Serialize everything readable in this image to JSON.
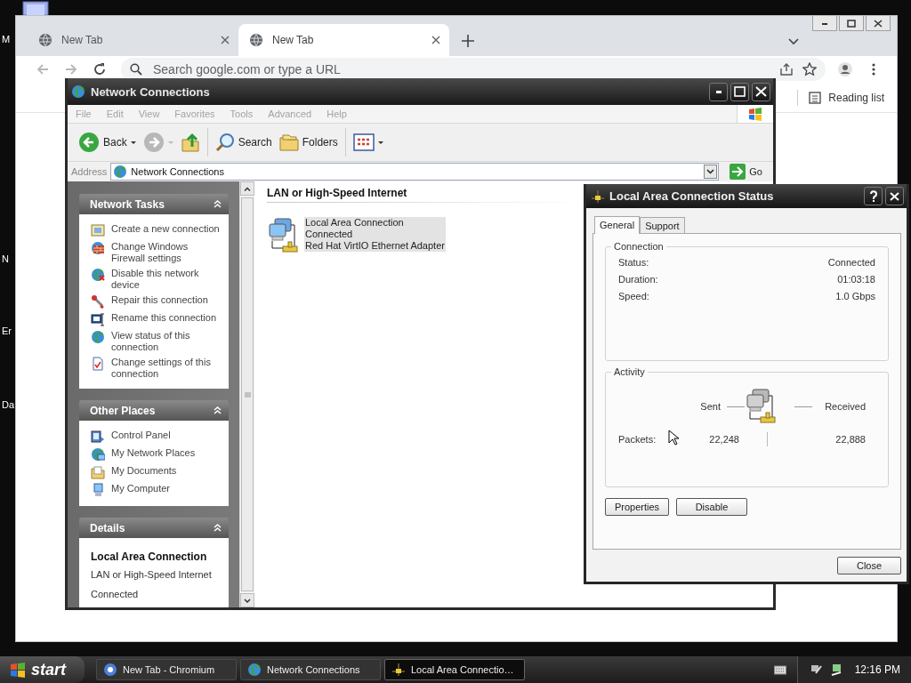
{
  "desktop": {
    "icon_labels": [
      "M",
      "N",
      "Er",
      "Da"
    ]
  },
  "browser": {
    "tabs": [
      {
        "title": "New Tab",
        "selected": false
      },
      {
        "title": "New Tab",
        "selected": true
      }
    ],
    "omnibox": {
      "placeholder": "Search google.com or type a URL"
    },
    "reading_list": "Reading list"
  },
  "explorer": {
    "title": "Network Connections",
    "menu": [
      "File",
      "Edit",
      "View",
      "Favorites",
      "Tools",
      "Advanced",
      "Help"
    ],
    "toolbar": [
      {
        "kind": "back",
        "label": "Back",
        "disabled": false
      },
      {
        "kind": "forward",
        "disabled": true
      },
      {
        "kind": "up",
        "disabled": false
      },
      {
        "kind": "search",
        "label": "Search",
        "disabled": false
      },
      {
        "kind": "folders",
        "label": "Folders",
        "disabled": false
      },
      {
        "kind": "views",
        "disabled": false
      }
    ],
    "address": {
      "label": "Address",
      "value": "Network Connections",
      "go": "Go"
    },
    "panels": [
      {
        "title": "Network Tasks",
        "items": [
          "Create a new connection",
          "Change Windows Firewall settings",
          "Disable this network device",
          "Repair this connection",
          "Rename this connection",
          "View status of this connection",
          "Change settings of this connection"
        ]
      },
      {
        "title": "Other Places",
        "items": [
          "Control Panel",
          "My Network Places",
          "My Documents",
          "My Computer"
        ]
      },
      {
        "title": "Details",
        "heading": "Local Area Connection",
        "items": [
          "LAN or High-Speed Internet",
          "Connected"
        ]
      }
    ],
    "group_heading": "LAN or High-Speed Internet",
    "connection": {
      "name": "Local Area Connection",
      "status": "Connected",
      "device": "Red Hat VirtIO Ethernet Adapter",
      "selected": true
    }
  },
  "status_dialog": {
    "title": "Local Area Connection Status",
    "tabs": [
      {
        "label": "General",
        "selected": true
      },
      {
        "label": "Support",
        "selected": false
      }
    ],
    "connection": {
      "legend": "Connection",
      "rows": [
        {
          "label": "Status:",
          "value": "Connected"
        },
        {
          "label": "Duration:",
          "value": "01:03:18"
        },
        {
          "label": "Speed:",
          "value": "1.0 Gbps"
        }
      ]
    },
    "activity": {
      "legend": "Activity",
      "sent": "Sent",
      "received": "Received",
      "packets_label": "Packets:",
      "packets_sent": "22,248",
      "packets_received": "22,888"
    },
    "buttons": [
      "Properties",
      "Disable"
    ],
    "close": "Close"
  },
  "taskbar": {
    "start": "start",
    "tasks": [
      {
        "title": "New Tab - Chromium",
        "selected": false
      },
      {
        "title": "Network Connections",
        "selected": false
      },
      {
        "title": "Local Area Connectio…",
        "selected": true
      }
    ],
    "clock": "12:16 PM"
  }
}
